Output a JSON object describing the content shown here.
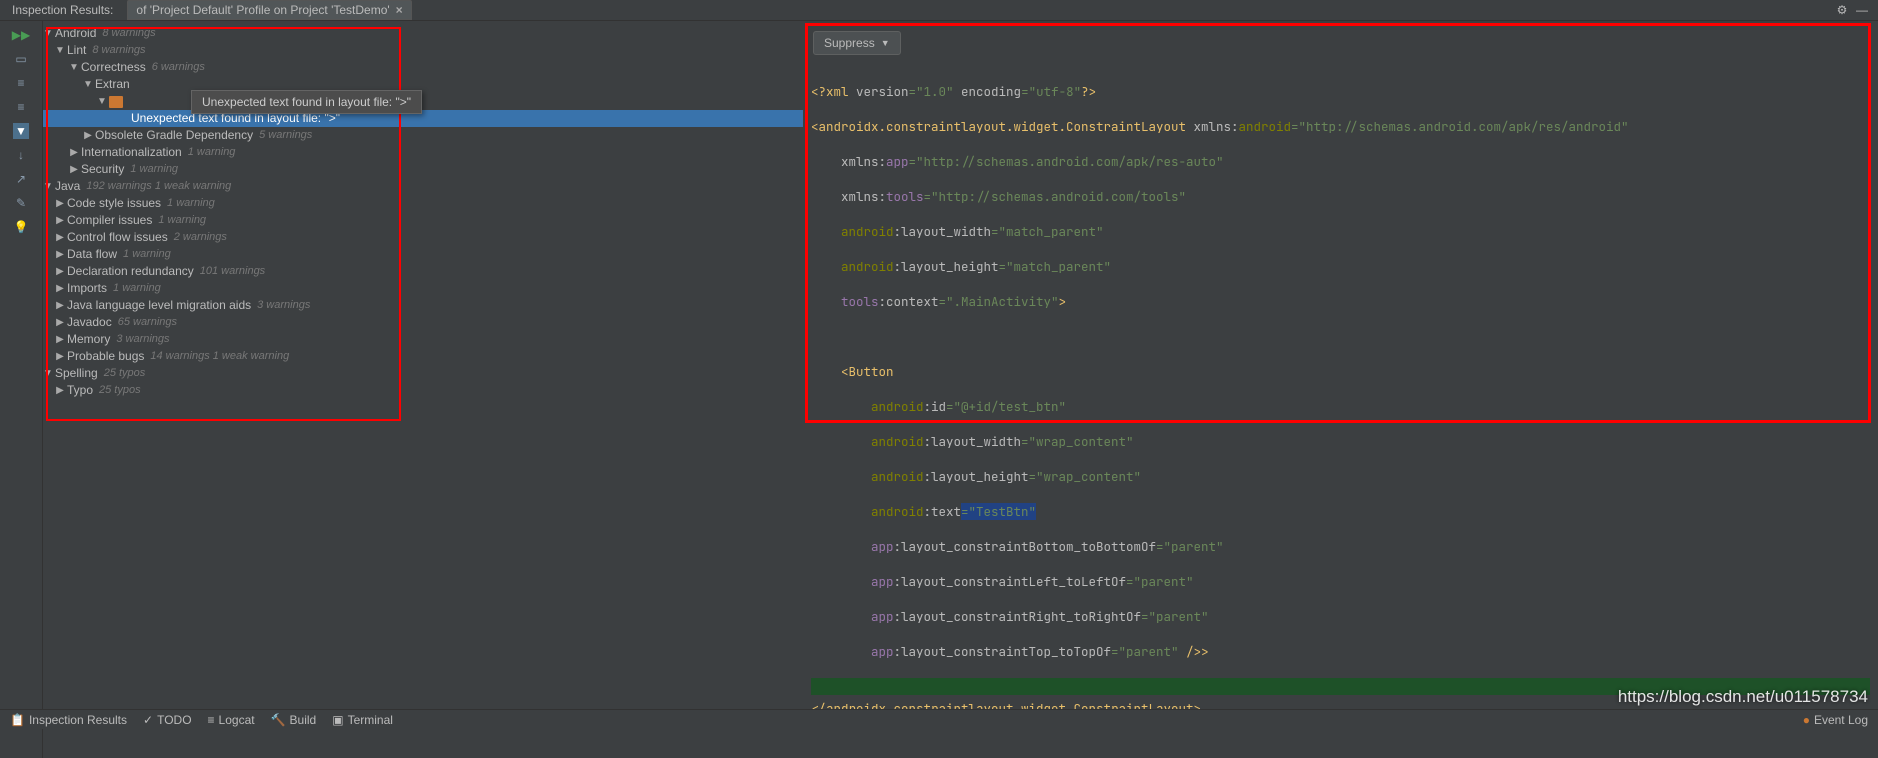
{
  "header": {
    "title": "Inspection Results:",
    "tab_label": "of 'Project Default' Profile on Project 'TestDemo'"
  },
  "tooltip": "Unexpected text found in layout file: \">\"",
  "selected_issue": "Unexpected text found in layout file: \">\"",
  "tree": {
    "android": {
      "label": "Android",
      "warn": "8 warnings"
    },
    "lint": {
      "label": "Lint",
      "warn": "8 warnings"
    },
    "correctness": {
      "label": "Correctness",
      "warn": "6 warnings"
    },
    "extran": {
      "label": "Extran"
    },
    "obsolete": {
      "label": "Obsolete Gradle Dependency",
      "warn": "5 warnings"
    },
    "intl": {
      "label": "Internationalization",
      "warn": "1 warning"
    },
    "security": {
      "label": "Security",
      "warn": "1 warning"
    },
    "java": {
      "label": "Java",
      "warn": "192 warnings 1 weak warning"
    },
    "code_style": {
      "label": "Code style issues",
      "warn": "1 warning"
    },
    "compiler": {
      "label": "Compiler issues",
      "warn": "1 warning"
    },
    "control_flow": {
      "label": "Control flow issues",
      "warn": "2 warnings"
    },
    "data_flow": {
      "label": "Data flow",
      "warn": "1 warning"
    },
    "decl_red": {
      "label": "Declaration redundancy",
      "warn": "101 warnings"
    },
    "imports": {
      "label": "Imports",
      "warn": "1 warning"
    },
    "java_lang": {
      "label": "Java language level migration aids",
      "warn": "3 warnings"
    },
    "javadoc": {
      "label": "Javadoc",
      "warn": "65 warnings"
    },
    "memory": {
      "label": "Memory",
      "warn": "3 warnings"
    },
    "probable": {
      "label": "Probable bugs",
      "warn": "14 warnings 1 weak warning"
    },
    "spelling": {
      "label": "Spelling",
      "warn": "25 typos"
    },
    "typo": {
      "label": "Typo",
      "warn": "25 typos"
    }
  },
  "suppress": {
    "label": "Suppress"
  },
  "code": {
    "l1_a": "<?xml",
    "l1_b": " version",
    "l1_c": "=\"1.0\"",
    "l1_d": " encoding",
    "l1_e": "=\"utf-8\"",
    "l1_f": "?>",
    "l2_a": "<androidx.constraintlayout.widget.ConstraintLayout",
    "l2_b": " xmlns:",
    "l2_c": "android",
    "l2_d": "=\"http://schemas.android.com/apk/res/android\"",
    "l3_a": "    xmlns:",
    "l3_b": "app",
    "l3_c": "=\"http://schemas.android.com/apk/res-auto\"",
    "l4_a": "    xmlns:",
    "l4_b": "tools",
    "l4_c": "=\"http://schemas.android.com/tools\"",
    "l5_a": "    ",
    "l5_b": "android",
    "l5_c": ":layout_width",
    "l5_d": "=\"match_parent\"",
    "l6_a": "    ",
    "l6_b": "android",
    "l6_c": ":layout_height",
    "l6_d": "=\"match_parent\"",
    "l7_a": "    ",
    "l7_b": "tools",
    "l7_c": ":context",
    "l7_d": "=\".MainActivity\"",
    "l7_e": ">",
    "l8_a": "    <Button",
    "l9_a": "        ",
    "l9_b": "android",
    "l9_c": ":id",
    "l9_d": "=\"@+id/test_btn\"",
    "l10_a": "        ",
    "l10_b": "android",
    "l10_c": ":layout_width",
    "l10_d": "=\"wrap_content\"",
    "l11_a": "        ",
    "l11_b": "android",
    "l11_c": ":layout_height",
    "l11_d": "=\"wrap_content\"",
    "l12_a": "        ",
    "l12_b": "android",
    "l12_c": ":text",
    "l12_d": "=\"TestBtn\"",
    "l13_a": "        ",
    "l13_b": "app",
    "l13_c": ":layout_constraintBottom_toBottomOf",
    "l13_d": "=\"parent\"",
    "l14_a": "        ",
    "l14_b": "app",
    "l14_c": ":layout_constraintLeft_toLeftOf",
    "l14_d": "=\"parent\"",
    "l15_a": "        ",
    "l15_b": "app",
    "l15_c": ":layout_constraintRight_toRightOf",
    "l15_d": "=\"parent\"",
    "l16_a": "        ",
    "l16_b": "app",
    "l16_c": ":layout_constraintTop_toTopOf",
    "l16_d": "=\"parent\"",
    "l16_e": " />",
    "l16_f": ">",
    "l17_a": "</androidx.constraintlayout.widget.ConstraintLayout>"
  },
  "bottom": {
    "inspection": "Inspection Results",
    "todo": "TODO",
    "logcat": "Logcat",
    "build": "Build",
    "terminal": "Terminal",
    "event_log": "Event Log"
  },
  "watermark": "https://blog.csdn.net/u011578734"
}
